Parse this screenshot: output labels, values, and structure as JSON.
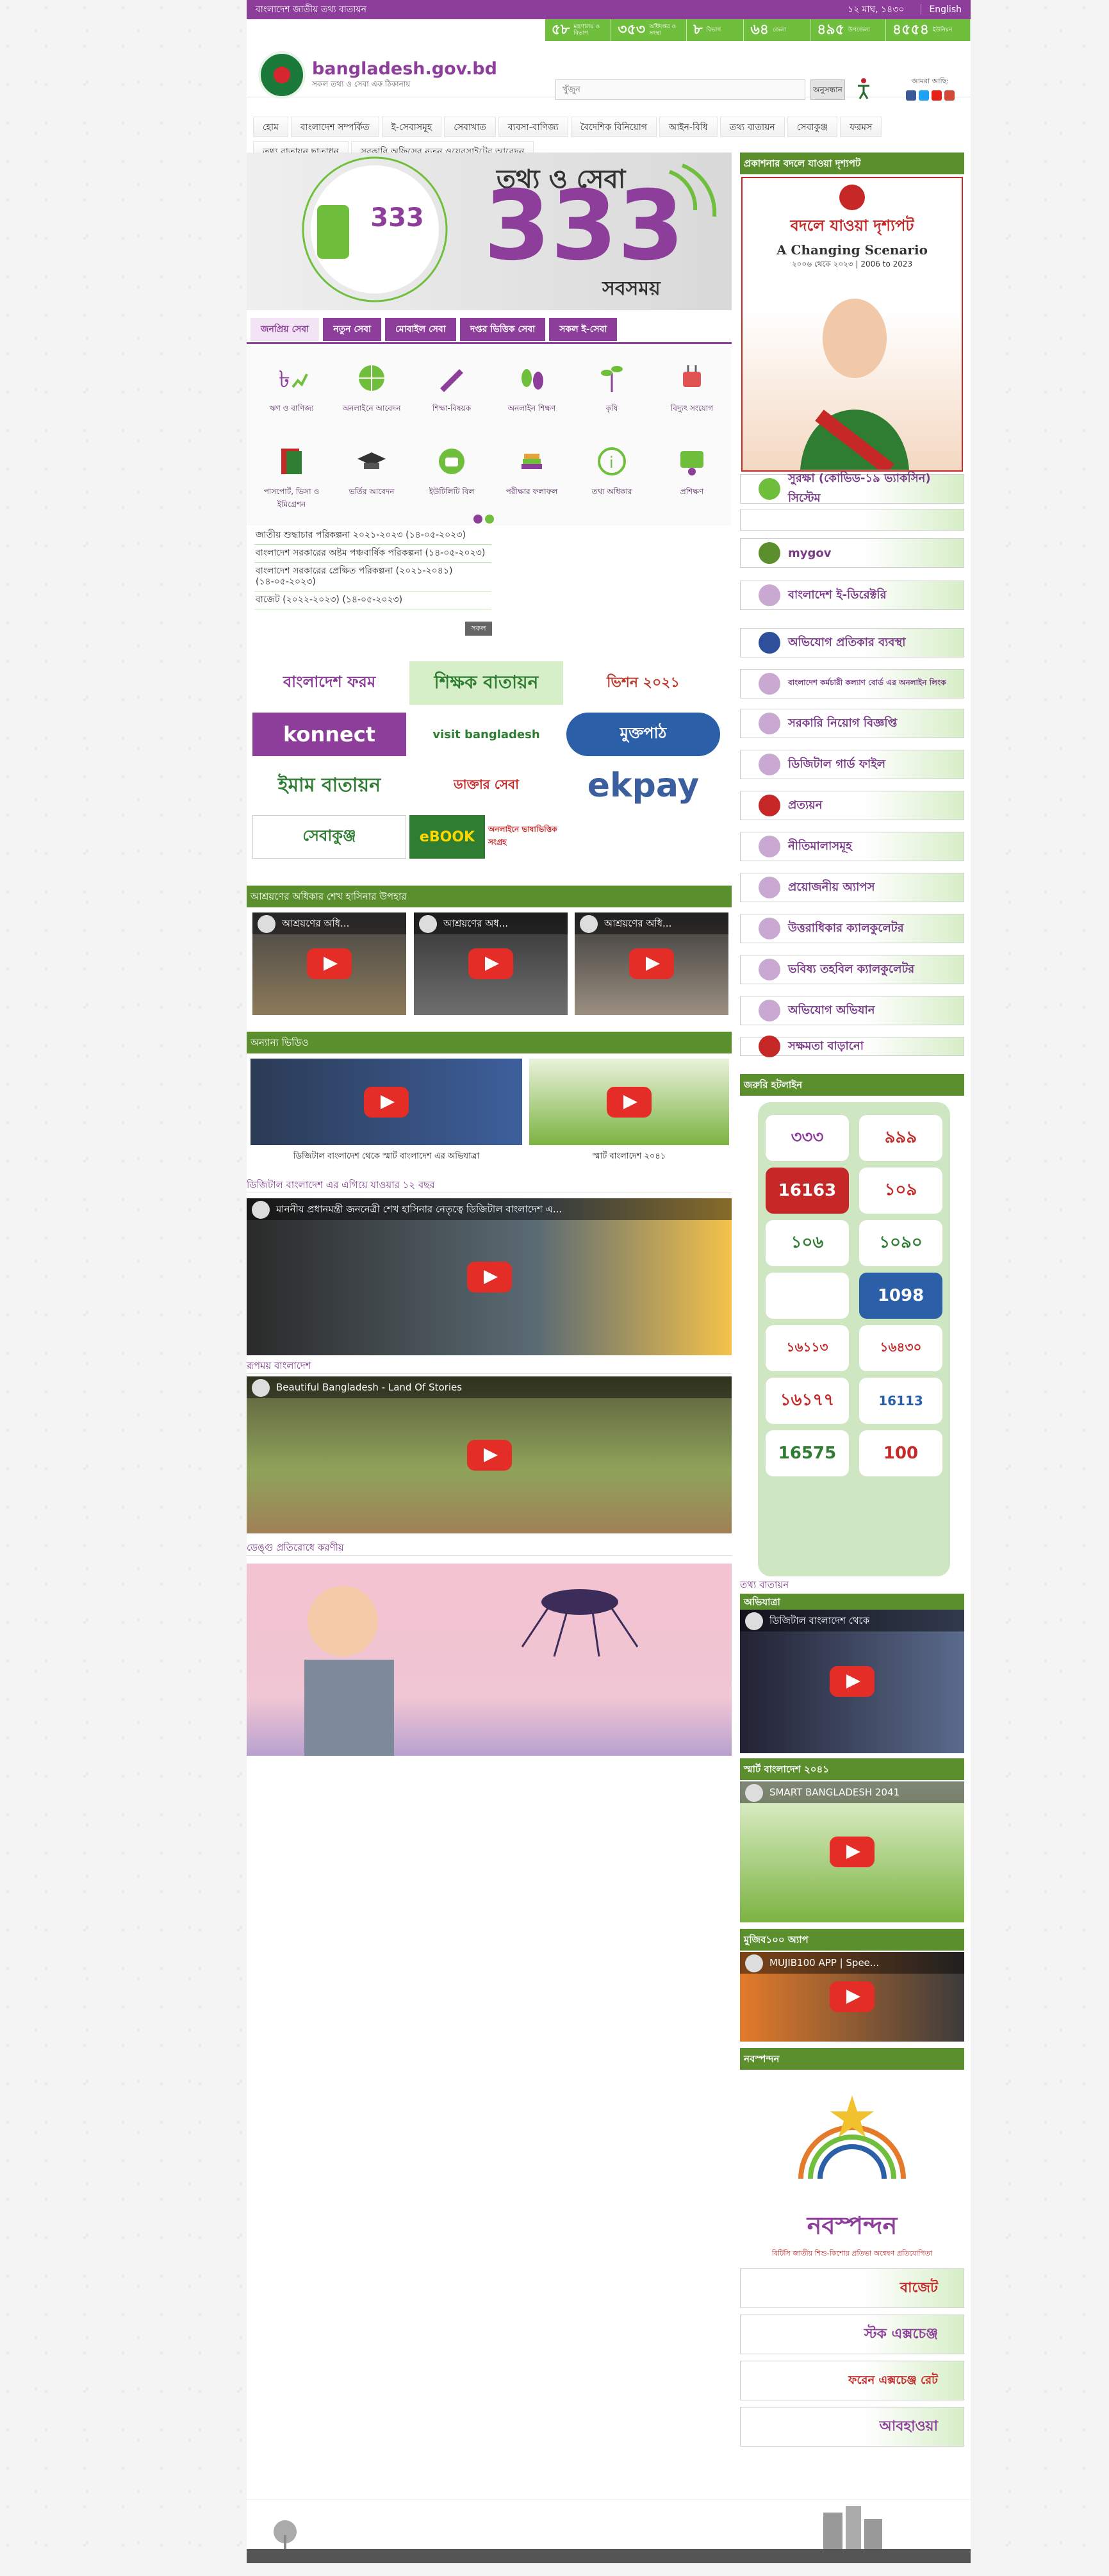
{
  "topbar": {
    "site": "বাংলাদেশ জাতীয় তথ্য বাতায়ন",
    "date": "১২ মাঘ, ১৪৩০",
    "lang": "English"
  },
  "stats": [
    {
      "num": "৫৮",
      "label": "মন্ত্রণালয় ও বিভাগ"
    },
    {
      "num": "৩৫৩",
      "label": "অধিদপ্তর ও সংস্থা"
    },
    {
      "num": "৮",
      "label": "বিভাগ"
    },
    {
      "num": "৬৪",
      "label": "জেলা"
    },
    {
      "num": "৪৯৫",
      "label": "উপজেলা"
    },
    {
      "num": "৪৫৫৪",
      "label": "ইউনিয়ন"
    }
  ],
  "brand": {
    "name": "bangladesh.gov.bd",
    "tagline": "সকল তথ্য ও সেবা এক ঠিকানায়"
  },
  "search": {
    "placeholder": "খুঁজুন",
    "button": "অনুসন্ধান"
  },
  "social": {
    "label": "আমরা আছি:"
  },
  "nav": [
    "হোম",
    "বাংলাদেশ সম্পর্কিত",
    "ই-সেবাসমূহ",
    "সেবাখাত",
    "ব্যবসা-বাণিজ্য",
    "বৈদেশিক বিনিয়োগ",
    "আইন-বিধি",
    "তথ্য বাতায়ন",
    "সেবাকুঞ্জ",
    "ফরমস",
    "তথ্য বাতায়ন ছাতাধন",
    "সরকারি অফিসের নতুন ওয়েবসাইটের আবেদন"
  ],
  "banner": {
    "title": "তথ্য ও সেবা",
    "number": "333",
    "sub": "সবসময়"
  },
  "tabs": [
    "জনপ্রিয় সেবা",
    "নতুন সেবা",
    "মোবাইল সেবা",
    "দপ্তর ভিত্তিক সেবা",
    "সকল ই-সেবা"
  ],
  "services": [
    "ঋণ ও বাণিজ্য",
    "অনলাইনে আবেদন",
    "শিক্ষা-বিষয়ক",
    "অনলাইন শিক্ষণ",
    "কৃষি",
    "বিদ্যুৎ সংযোগ",
    "পাসপোর্ট, ভিসা ও ইমিগ্রেশন",
    "ভর্তির আবেদন",
    "ইউটিলিটি বিল",
    "পরীক্ষার ফলাফল",
    "তথ্য অধিকার",
    "প্রশিক্ষণ"
  ],
  "notices": [
    "জাতীয় শুদ্ধাচার পরিকল্পনা ২০২১-২০২৩ (১৪-০৫-২০২৩)",
    "বাংলাদেশ সরকারের অষ্টম পঞ্চবার্ষিক পরিকল্পনা (১৪-০৫-২০২৩)",
    "বাংলাদেশ সরকারের প্রেক্ষিত পরিকল্পনা (২০২১-২০৪১) (১৪-০৫-২০২৩)",
    "বাজেট (২০২২-২০২৩) (১৪-০৫-২০২৩)"
  ],
  "notices_all": "সকল",
  "logos": [
    "বাংলাদেশ ফরম",
    "শিক্ষক বাতায়ন",
    "ভিশন ২০২১",
    "konnect",
    "visit bangladesh",
    "মুক্তপাঠ",
    "ইমাম বাতায়ন",
    "ডাক্তার সেবা",
    "ekpay",
    "সেবাকুঞ্জ",
    "eBOOK",
    "অনলাইনে ভাষাভিত্তিক সংগ্রহ"
  ],
  "sections": {
    "ashrayan": "আশ্রয়ণের অধিকার শেখ হাসিনার উপহার",
    "other_video": "অন্যান্য ভিডিও",
    "digital12": "ডিজিটাল বাংলাদেশ এর এগিয়ে যাওয়ার ১২ বছর",
    "beautiful": "রূপময় বাংলাদেশ",
    "dengue": "ডেঙ্গু প্রতিরোধে করণীয়"
  },
  "videos": {
    "ash": [
      "আশ্রয়ণের অধি...",
      "আশ্রয়ণের অধ...",
      "আশ্রয়ণের অধি..."
    ],
    "other_caps": [
      "ডিজিটাল বাংলাদেশ থেকে স্মার্ট বাংলাদেশ এর অভিযাত্রা",
      "স্মার্ট বাংলাদেশ ২০৪১"
    ],
    "digital_title": "মাননীয় প্রধানমন্ত্রী জননেত্রী শেখ হাসিনার নেতৃত্বে ডিজিটাল বাংলাদেশ এ...",
    "beautiful_title": "Beautiful Bangladesh - Land Of Stories"
  },
  "side": {
    "head1": "প্রকাশনার বদলে যাওয়া দৃশ্যপট",
    "book_title": "বদলে যাওয়া দৃশ্যপট",
    "book_en": "A Changing Scenario",
    "book_years": "২০০৬ থেকে ২০২৩ | 2006 to 2023",
    "links": [
      "সুরক্ষা (কোভিড-১৯ ভ্যাকসিন) সিস্টেম",
      "",
      "mygov",
      "বাংলাদেশ ই-ডিরেক্টরি",
      "অভিযোগ প্রতিকার ব্যবস্থা",
      "বাংলাদেশ কর্মচারী কল্যাণ বোর্ড এর অনলাইন লিংক",
      "সরকারি নিয়োগ বিজ্ঞপ্তি",
      "ডিজিটাল গার্ড ফাইল",
      "প্রত্যয়ন",
      "নীতিমালাসমূহ",
      "প্রয়োজনীয় অ্যাপস",
      "উত্তরাধিকার ক্যালকুলেটর",
      "ভবিষ্য তহবিল ক্যালকুলেটর",
      "অভিযোগ অভিযান",
      "সক্ষমতা বাড়ানো"
    ],
    "hotline_head": "জরুরি হটলাইন",
    "hotlines": [
      "৩৩৩",
      "৯৯৯",
      "16163",
      "১০৯",
      "১০৬",
      "১০৯০",
      "",
      "1098",
      "১৬১১৩",
      "১৬৪৩০",
      "১৬১৭৭",
      "16113",
      "16575",
      "100"
    ],
    "tathya": "তথ্য বাতায়ন",
    "video_heads": [
      "অভিযাত্রা",
      "স্মার্ট বাংলাদেশ ২০৪১",
      "মুজিব১০০ অ্যাপ",
      "নবস্পন্দন"
    ],
    "video_titles": [
      "ডিজিটাল বাংলাদেশ থেকে",
      "SMART BANGLADESH 2041",
      "MUJIB100 APP | Spee..."
    ],
    "nobo": "নবস্পন্দন",
    "nobo_sub": "বিটিসি জাতীয় শিশু-কিশোর প্রতিভা অন্বেষণ প্রতিযোগিতা",
    "bottom_links": [
      "বাজেট",
      "স্টক এক্সচেঞ্জ",
      "ফরেন এক্সচেঞ্জ রেট",
      "আবহাওয়া"
    ]
  },
  "colors": {
    "purple": "#8d3e9b",
    "green": "#6fbf3c",
    "darkgreen": "#5b8f2e"
  }
}
